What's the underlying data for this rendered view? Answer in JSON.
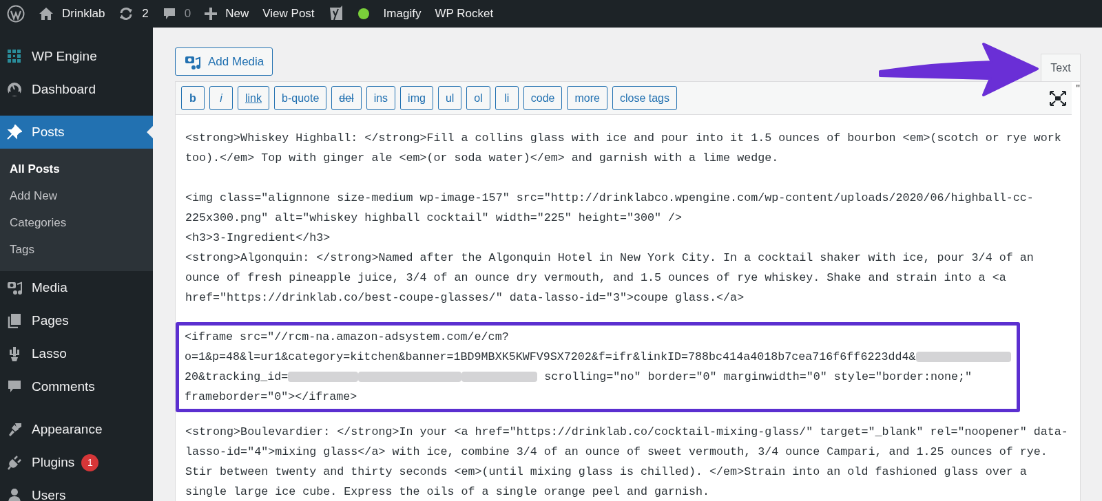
{
  "admin_bar": {
    "items": [
      {
        "label": "Drinklab",
        "disabled": false
      },
      {
        "label": "2",
        "disabled": false
      },
      {
        "label": "0",
        "disabled": true
      },
      {
        "label": "New",
        "disabled": false
      },
      {
        "label": "View Post",
        "disabled": false
      },
      {
        "label": "Imagify",
        "disabled": false
      },
      {
        "label": "WP Rocket",
        "disabled": false
      }
    ]
  },
  "sidebar": {
    "groups": [
      {
        "items": [
          {
            "label": "WP Engine",
            "current": false
          },
          {
            "label": "Dashboard",
            "current": false
          }
        ]
      },
      {
        "items": [
          {
            "label": "Posts",
            "current": true,
            "children": [
              {
                "label": "All Posts",
                "selected": true
              },
              {
                "label": "Add New",
                "selected": false
              },
              {
                "label": "Categories",
                "selected": false
              },
              {
                "label": "Tags",
                "selected": false
              }
            ]
          },
          {
            "label": "Media",
            "current": false
          },
          {
            "label": "Pages",
            "current": false
          },
          {
            "label": "Lasso",
            "current": false
          },
          {
            "label": "Comments",
            "current": false
          }
        ]
      },
      {
        "items": [
          {
            "label": "Appearance",
            "current": false
          },
          {
            "label": "Plugins",
            "current": false,
            "badge": "1"
          },
          {
            "label": "Users",
            "current": false
          }
        ]
      }
    ]
  },
  "editor": {
    "add_media": "Add Media",
    "tabs": [
      {
        "label": "Text",
        "selected": true
      }
    ],
    "toolbar": [
      {
        "label": "b",
        "kind": "bold"
      },
      {
        "label": "i",
        "kind": "italic"
      },
      {
        "label": "link",
        "kind": "link"
      },
      {
        "label": "b-quote",
        "kind": "plain"
      },
      {
        "label": "del",
        "kind": "del"
      },
      {
        "label": "ins",
        "kind": "plain"
      },
      {
        "label": "img",
        "kind": "plain"
      },
      {
        "label": "ul",
        "kind": "plain"
      },
      {
        "label": "ol",
        "kind": "plain"
      },
      {
        "label": "li",
        "kind": "plain"
      },
      {
        "label": "code",
        "kind": "plain"
      },
      {
        "label": "more",
        "kind": "plain"
      },
      {
        "label": "close tags",
        "kind": "plain"
      }
    ],
    "stray_text": "\"",
    "content": [
      {
        "kind": "paragraph",
        "lines": [
          "<strong>Whiskey Highball: </strong>Fill a collins glass with ice and pour into it 1.5 ounces of bourbon <em>(scotch or rye work too).</em> Top with ginger ale <em>(or soda water)</em> and garnish with a lime wedge."
        ]
      },
      {
        "kind": "paragraph",
        "lines": [
          "<img class=\"alignnone size-medium wp-image-157\" src=\"http://drinklabco.wpengine.com/wp-content/uploads/2020/06/highball-cc-225x300.png\" alt=\"whiskey highball cocktail\" width=\"225\" height=\"300\" />",
          "<h3>3-Ingredient</h3>",
          "<strong>Algonquin: </strong>Named after the Algonquin Hotel in New York City. In a cocktail shaker with ice, pour 3/4 of an ounce of fresh pineapple juice, 3/4 of an ounce dry vermouth, and 1.5 ounces of rye whiskey. Shake and strain into a <a href=\"https://drinklab.co/best-coupe-glasses/\" data-lasso-id=\"3\">coupe glass.</a>"
        ]
      },
      {
        "kind": "highlight",
        "rows": [
          [
            {
              "kind": "text",
              "text": "<iframe src=\"//rcm-na.amazon-adsystem.com/e/cm?"
            }
          ],
          [
            {
              "kind": "text",
              "text": "o=1&p=48&l=ur1&category=kitchen&banner=1BD9MBXK5KWFV9SX7202&f=ifr&linkID=788bc414a4018b7cea716f6ff6223dd4&"
            },
            {
              "kind": "redacted"
            }
          ],
          [
            {
              "kind": "text",
              "text": "20&tracking_id="
            },
            {
              "kind": "redacted"
            },
            {
              "kind": "redacted"
            },
            {
              "kind": "redacted"
            },
            {
              "kind": "text",
              "text": " scrolling=\"no\" border=\"0\" marginwidth=\"0\" style=\"border:none;\""
            }
          ],
          [
            {
              "kind": "text",
              "text": "frameborder=\"0\"></iframe>"
            }
          ]
        ]
      },
      {
        "kind": "paragraph",
        "lines": [
          "<strong>Boulevardier: </strong>In your <a href=\"https://drinklab.co/cocktail-mixing-glass/\" target=\"_blank\" rel=\"noopener\" data-lasso-id=\"4\">mixing glass</a> with ice, combine 3/4 of an ounce of sweet vermouth, 3/4 ounce Campari, and 1.25 ounces of rye. Stir between twenty and thirty seconds <em>(until mixing glass is chilled). </em>Strain into an old fashioned glass over a single large ice cube. Express the oils of a single orange peel and garnish."
        ]
      }
    ]
  }
}
